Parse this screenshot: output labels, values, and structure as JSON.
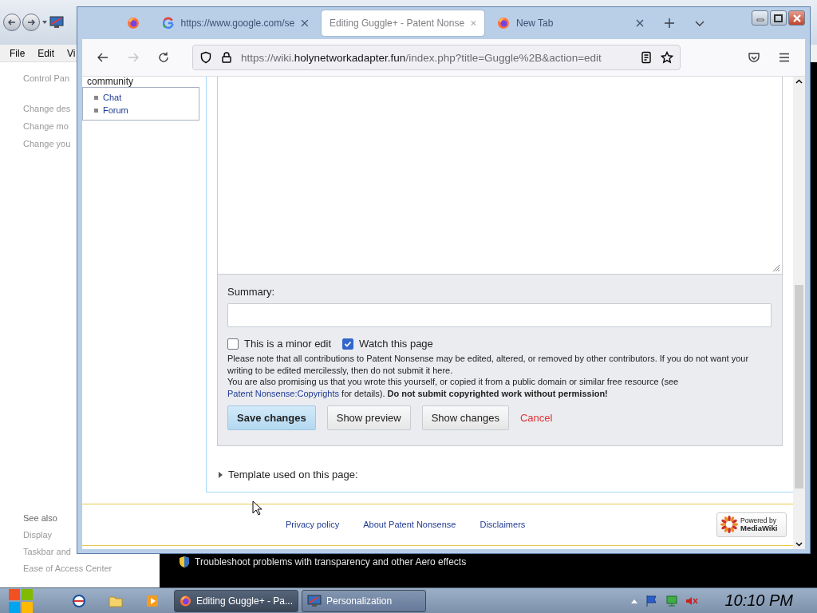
{
  "background_window": {
    "menu": [
      "File",
      "Edit",
      "Vi"
    ],
    "breadcrumb": "Control Pan",
    "tasks": [
      "Change des",
      "Change mo",
      "Change you"
    ],
    "see_also": {
      "title": "See also",
      "links": [
        "Display",
        "Taskbar and",
        "Ease of Access Center"
      ]
    },
    "troubleshoot_link": "Troubleshoot problems with transparency and other Aero effects"
  },
  "browser": {
    "tabs": [
      {
        "kind": "pinned",
        "selected": false
      },
      {
        "kind": "page",
        "label": "https://www.google.com/se",
        "selected": false
      },
      {
        "kind": "page",
        "label": "Editing Guggle+ - Patent Nonse",
        "selected": true
      },
      {
        "kind": "page",
        "label": "New Tab",
        "selected": false
      }
    ],
    "back": {
      "disabled": false
    },
    "forward": {
      "disabled": true
    },
    "url": {
      "prefix": "https://wiki.",
      "domain": "holynetworkadapter.fun",
      "path": "/index.php?title=Guggle%2B&action=edit"
    }
  },
  "page": {
    "sidebar": {
      "heading": "community",
      "links": [
        "Chat",
        "Forum"
      ]
    },
    "editor": {
      "summary_label": "Summary:",
      "checkboxes": [
        {
          "label": "This is a minor edit",
          "checked": false
        },
        {
          "label": "Watch this page",
          "checked": true
        }
      ],
      "notice": "Please note that all contributions to Patent Nonsense may be edited, altered, or removed by other contributors. If you do not want your writing to be edited mercilessly, then do not submit it here.",
      "copyright": {
        "before": "You are also promising us that you wrote this yourself, or copied it from a public domain or similar free resource (see ",
        "link": "Patent Nonsense:Copyrights",
        "after": " for details). **Do not submit copyrighted work without permission!**"
      },
      "buttons": [
        {
          "label": "Save changes",
          "kind": "primary"
        },
        {
          "label": "Show preview",
          "kind": "normal"
        },
        {
          "label": "Show changes",
          "kind": "normal"
        },
        {
          "label": "Cancel",
          "kind": "link"
        }
      ]
    },
    "template": {
      "label": "Template used on this page:",
      "expanded": false
    },
    "footer": {
      "links": [
        "Privacy policy",
        "About Patent Nonsense",
        "Disclaimers"
      ],
      "badge": {
        "line1": "Powered by",
        "line2": "MediaWiki"
      }
    }
  },
  "taskbar": {
    "tasks": [
      {
        "label": "Editing Guggle+ - Pa...",
        "selected": true
      },
      {
        "label": "Personalization",
        "selected": false
      }
    ],
    "clock": "10:10 PM"
  }
}
